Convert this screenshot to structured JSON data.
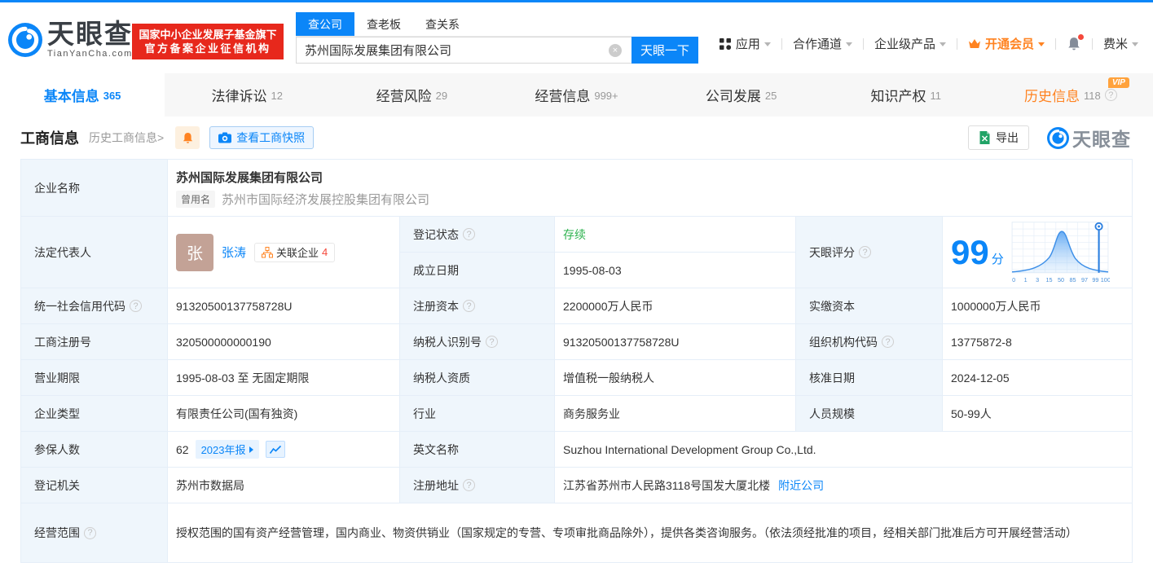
{
  "brand": {
    "name": "天眼查",
    "domain": "TianYanCha.com",
    "badge_line1": "国家中小企业发展子基金旗下",
    "badge_line2": "官方备案企业征信机构"
  },
  "search": {
    "tabs": [
      {
        "label": "查公司",
        "active": true
      },
      {
        "label": "查老板",
        "active": false
      },
      {
        "label": "查关系",
        "active": false
      }
    ],
    "input_value": "苏州国际发展集团有限公司",
    "button_label": "天眼一下"
  },
  "nav": {
    "apps": "应用",
    "partner": "合作通道",
    "enterprise": "企业级产品",
    "vip": "开通会员",
    "user": "费米"
  },
  "tabs": [
    {
      "label": "基本信息",
      "count": "365",
      "active": true
    },
    {
      "label": "法律诉讼",
      "count": "12"
    },
    {
      "label": "经营风险",
      "count": "29"
    },
    {
      "label": "经营信息",
      "count": "999+"
    },
    {
      "label": "公司发展",
      "count": "25"
    },
    {
      "label": "知识产权",
      "count": "11"
    },
    {
      "label": "历史信息",
      "count": "118",
      "vip": "VIP"
    }
  ],
  "section": {
    "title": "工商信息",
    "history_link": "历史工商信息>",
    "snapshot_button": "查看工商快照",
    "export_button": "导出",
    "brand_watermark": "天眼查"
  },
  "score": {
    "label": "天眼评分",
    "value": "99",
    "unit": "分",
    "ticks": [
      "0",
      "1",
      "3",
      "15",
      "50",
      "85",
      "97",
      "99",
      "100"
    ]
  },
  "fields": {
    "name": {
      "label": "企业名称",
      "value": "苏州国际发展集团有限公司",
      "former_badge": "曾用名",
      "former": "苏州市国际经济发展控股集团有限公司"
    },
    "legal": {
      "label": "法定代表人",
      "avatar": "张",
      "name": "张涛",
      "rel_label": "关联企业",
      "rel_count": "4"
    },
    "reg_status": {
      "label": "登记状态",
      "value": "存续"
    },
    "est_date": {
      "label": "成立日期",
      "value": "1995-08-03"
    },
    "credit_code": {
      "label": "统一社会信用代码",
      "value": "91320500137758728U"
    },
    "reg_capital": {
      "label": "注册资本",
      "value": "2200000万人民币"
    },
    "paid_capital": {
      "label": "实缴资本",
      "value": "1000000万人民币"
    },
    "reg_number": {
      "label": "工商注册号",
      "value": "320500000000190"
    },
    "taxpayer_id": {
      "label": "纳税人识别号",
      "value": "91320500137758728U"
    },
    "org_code": {
      "label": "组织机构代码",
      "value": "13775872-8"
    },
    "term": {
      "label": "营业期限",
      "value": "1995-08-03 至 无固定期限"
    },
    "taxpayer_quality": {
      "label": "纳税人资质",
      "value": "增值税一般纳税人"
    },
    "approval_date": {
      "label": "核准日期",
      "value": "2024-12-05"
    },
    "type": {
      "label": "企业类型",
      "value": "有限责任公司(国有独资)"
    },
    "industry": {
      "label": "行业",
      "value": "商务服务业"
    },
    "staff": {
      "label": "人员规模",
      "value": "50-99人"
    },
    "insured": {
      "label": "参保人数",
      "value": "62",
      "report_badge": "2023年报"
    },
    "english": {
      "label": "英文名称",
      "value": "Suzhou International Development Group Co.,Ltd."
    },
    "authority": {
      "label": "登记机关",
      "value": "苏州市数据局"
    },
    "address": {
      "label": "注册地址",
      "value": "江苏省苏州市人民路3118号国发大厦北楼",
      "nearby": "附近公司"
    },
    "scope": {
      "label": "经营范围",
      "value": "授权范围的国有资产经营管理，国内商业、物资供销业（国家规定的专营、专项审批商品除外），提供各类咨询服务。（依法须经批准的项目，经相关部门批准后方可开展经营活动）"
    }
  },
  "icons": {
    "help": "?",
    "clear": "×"
  },
  "colors": {
    "primary": "#0b86f8",
    "orange": "#ff8321",
    "green": "#2fb350",
    "badge_red": "#e7281c"
  }
}
